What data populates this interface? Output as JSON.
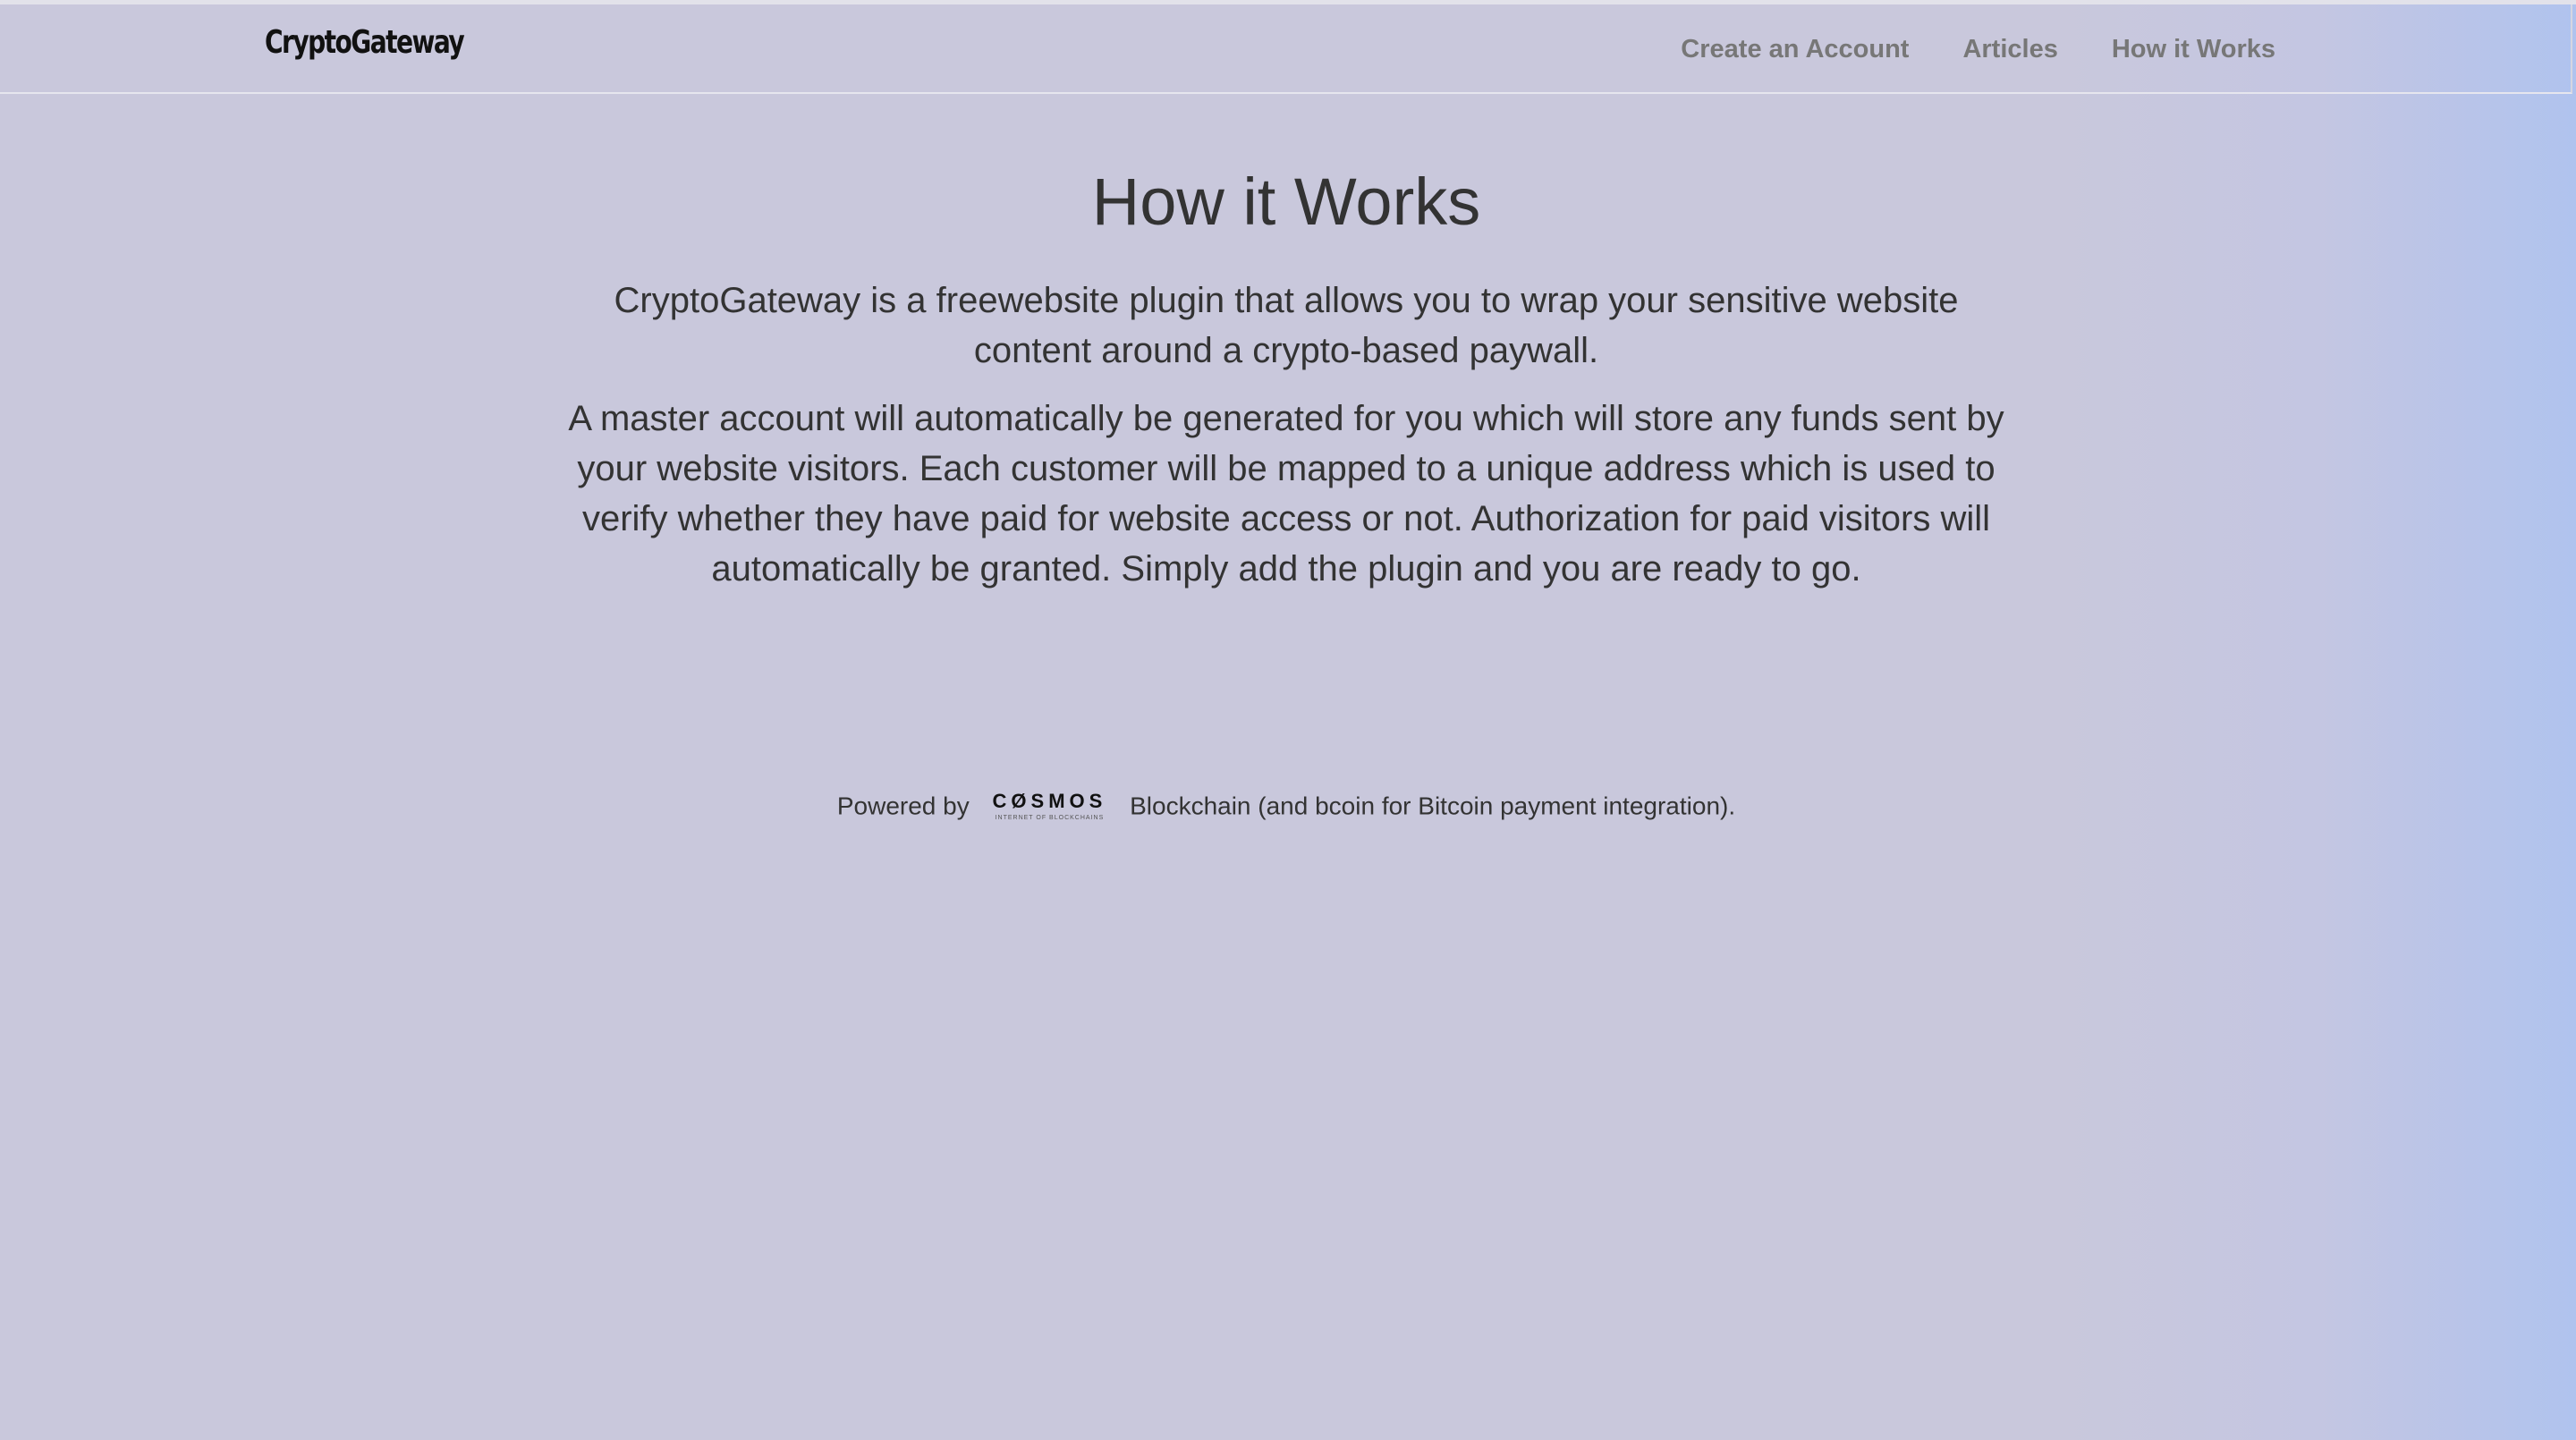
{
  "navbar": {
    "brand": "CryptoGateway",
    "links": [
      {
        "label": "Create an Account"
      },
      {
        "label": "Articles"
      },
      {
        "label": "How it Works"
      }
    ]
  },
  "main": {
    "title": "How it Works",
    "paragraphs": [
      "CryptoGateway is a freewebsite plugin that allows you to wrap your sensitive website content around a crypto-based paywall.",
      "A master account will automatically be generated for you which will store any funds sent by your website visitors. Each customer will be mapped to a unique address which is used to verify whether they have paid for website access or not. Authorization for paid visitors will automatically be granted. Simply add the plugin and you are ready to go."
    ]
  },
  "footer": {
    "powered_prefix": "Powered by",
    "logo_word": "CØSMOS",
    "logo_tagline": "INTERNET OF BLOCKCHAINS",
    "powered_suffix": "Blockchain (and bcoin for Bitcoin payment integration)."
  },
  "colors": {
    "background": "#c9c8dc",
    "background_edge": "#b0c3ee",
    "text": "#333333",
    "nav_link": "#777777"
  }
}
